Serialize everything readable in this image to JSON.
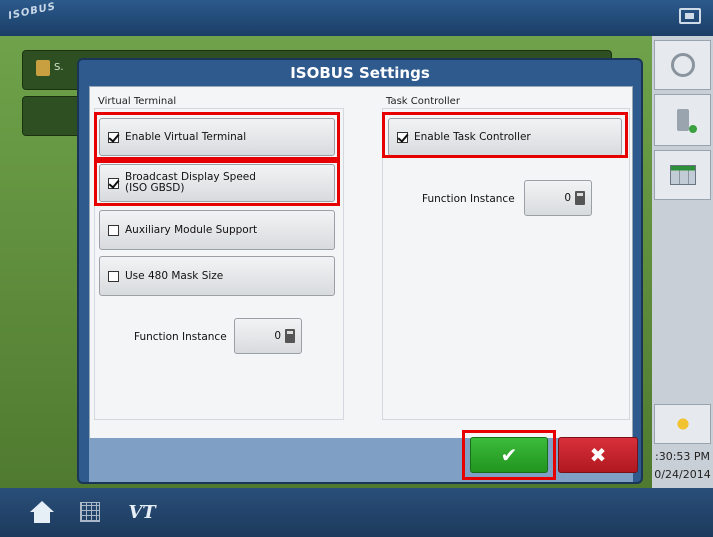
{
  "app": {
    "top_logo": "ISOBUS",
    "time": ":30:53 PM",
    "date": "0/24/2014"
  },
  "dialog": {
    "title": "ISOBUS Settings"
  },
  "virtual_terminal": {
    "section_label": "Virtual Terminal",
    "enable_vt": {
      "label": "Enable Virtual Terminal",
      "checked": true
    },
    "broadcast_speed": {
      "label_line1": "Broadcast Display Speed",
      "label_line2": "(ISO GBSD)",
      "checked": true
    },
    "aux_module": {
      "label": "Auxiliary Module Support",
      "checked": false
    },
    "mask_480": {
      "label": "Use 480 Mask Size",
      "checked": false
    },
    "function_instance": {
      "label": "Function Instance",
      "value": "0"
    }
  },
  "task_controller": {
    "section_label": "Task Controller",
    "enable_tc": {
      "label": "Enable Task Controller",
      "checked": true
    },
    "function_instance": {
      "label": "Function Instance",
      "value": "0"
    }
  },
  "footer": {
    "ok_glyph": "✔",
    "cancel_glyph": "✖"
  },
  "icons": {
    "wrench": "wrench-icon",
    "usb": "usb-icon",
    "grid": "table-icon",
    "weather": "weather-icon",
    "home": "home-icon",
    "keypad": "keypad-icon",
    "vt": "VT"
  },
  "colors": {
    "title_bar": "#2e5a8e",
    "highlight": "#e60000",
    "ok": "#2aa52a",
    "cancel": "#c8242c"
  }
}
